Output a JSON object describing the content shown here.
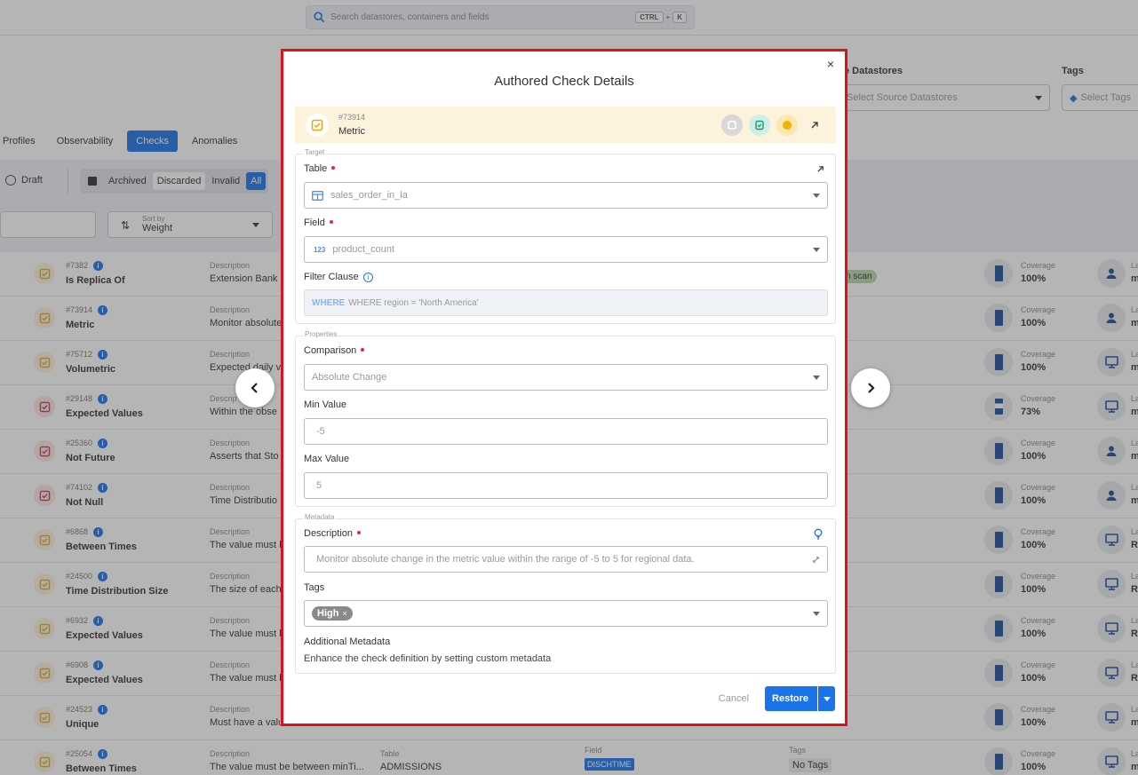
{
  "search": {
    "placeholder": "Search datastores, containers and fields",
    "kbd1": "CTRL",
    "kbd_plus": "+",
    "kbd2": "K"
  },
  "filters": {
    "source_label": "e Datastores",
    "source_placeholder": "Select Source Datastores",
    "tags_label": "Tags",
    "tags_placeholder": "Select Tags"
  },
  "tabs": [
    "Profiles",
    "Observability",
    "Checks",
    "Anomalies"
  ],
  "status": {
    "draft": "Draft",
    "archived": "Archived",
    "discarded": "Discarded",
    "invalid": "Invalid",
    "all": "All"
  },
  "sort": {
    "label": "Sort by",
    "value": "Weight"
  },
  "rows": [
    {
      "id": "#7382",
      "name": "Is Replica Of",
      "desc_label": "Description",
      "desc": "Extension Bank r",
      "coverage_label": "Coverage",
      "coverage": "100%",
      "owner": "user",
      "extra": "n scan",
      "cut": "m"
    },
    {
      "id": "#73914",
      "name": "Metric",
      "desc_label": "Description",
      "desc": "Monitor absolute",
      "coverage_label": "Coverage",
      "coverage": "100%",
      "owner": "user",
      "cut": "m"
    },
    {
      "id": "#75712",
      "name": "Volumetric",
      "desc_label": "Description",
      "desc": "Expected daily v",
      "coverage_label": "Coverage",
      "coverage": "100%",
      "owner": "monitor",
      "cut": "m"
    },
    {
      "id": "#29148",
      "name": "Expected Values",
      "desc_label": "Descrip",
      "desc": "Within the obse",
      "coverage_label": "Coverage",
      "coverage": "73%",
      "owner": "monitor",
      "cut": "m"
    },
    {
      "id": "#25360",
      "name": "Not Future",
      "desc_label": "Description",
      "desc": "Asserts that Sto",
      "coverage_label": "Coverage",
      "coverage": "100%",
      "owner": "user",
      "cut": "m"
    },
    {
      "id": "#74102",
      "name": "Not Null",
      "desc_label": "Description",
      "desc": "Time Distributio",
      "coverage_label": "Coverage",
      "coverage": "100%",
      "owner": "user",
      "cut": "m"
    },
    {
      "id": "#6868",
      "name": "Between Times",
      "desc_label": "Description",
      "desc": "The value must b",
      "coverage_label": "Coverage",
      "coverage": "100%",
      "owner": "monitor",
      "cut": "R"
    },
    {
      "id": "#24500",
      "name": "Time Distribution Size",
      "desc_label": "Description",
      "desc": "The size of each",
      "coverage_label": "Coverage",
      "coverage": "100%",
      "owner": "monitor",
      "cut": "R"
    },
    {
      "id": "#6932",
      "name": "Expected Values",
      "desc_label": "Description",
      "desc": "The value must b",
      "coverage_label": "Coverage",
      "coverage": "100%",
      "owner": "monitor",
      "cut": "R"
    },
    {
      "id": "#6908",
      "name": "Expected Values",
      "desc_label": "Description",
      "desc": "The value must b",
      "coverage_label": "Coverage",
      "coverage": "100%",
      "owner": "monitor",
      "cut": "R"
    },
    {
      "id": "#24523",
      "name": "Unique",
      "desc_label": "Description",
      "desc": "Must have a valu",
      "coverage_label": "Coverage",
      "coverage": "100%",
      "owner": "monitor",
      "cut": "m"
    },
    {
      "id": "#25054",
      "name": "Between Times",
      "desc_label": "Description",
      "desc": "The value must be between minTi...",
      "table_label": "Table",
      "table": "ADMISSIONS",
      "field_label": "Field",
      "field": "DISCHTIME",
      "tags_label": "Tags",
      "tags": "No Tags",
      "coverage_label": "Coverage",
      "coverage": "100%",
      "owner": "monitor",
      "cut": "m"
    }
  ],
  "modal": {
    "title": "Authored Check Details",
    "close": "×",
    "check": {
      "id": "#73914",
      "name": "Metric"
    },
    "target": {
      "legend": "Target",
      "table_label": "Table",
      "table_value": "sales_order_in_la",
      "field_label": "Field",
      "field_prefix": "123",
      "field_value": "product_count",
      "filter_label": "Filter Clause",
      "filter_keyword": "WHERE",
      "filter_value": "WHERE region = 'North America'"
    },
    "properties": {
      "legend": "Properties",
      "comparison_label": "Comparison",
      "comparison_value": "Absolute Change",
      "min_label": "Min Value",
      "min_value": "-5",
      "max_label": "Max Value",
      "max_value": "5"
    },
    "metadata": {
      "legend": "Metadata",
      "description_label": "Description",
      "description_value": "Monitor absolute change in the metric value within the range of -5 to 5 for regional data.",
      "tags_label": "Tags",
      "tag": "High",
      "tag_remove": "×",
      "additional_label": "Additional Metadata",
      "additional_hint": "Enhance the check definition by setting custom metadata"
    },
    "cancel": "Cancel",
    "restore": "Restore"
  }
}
